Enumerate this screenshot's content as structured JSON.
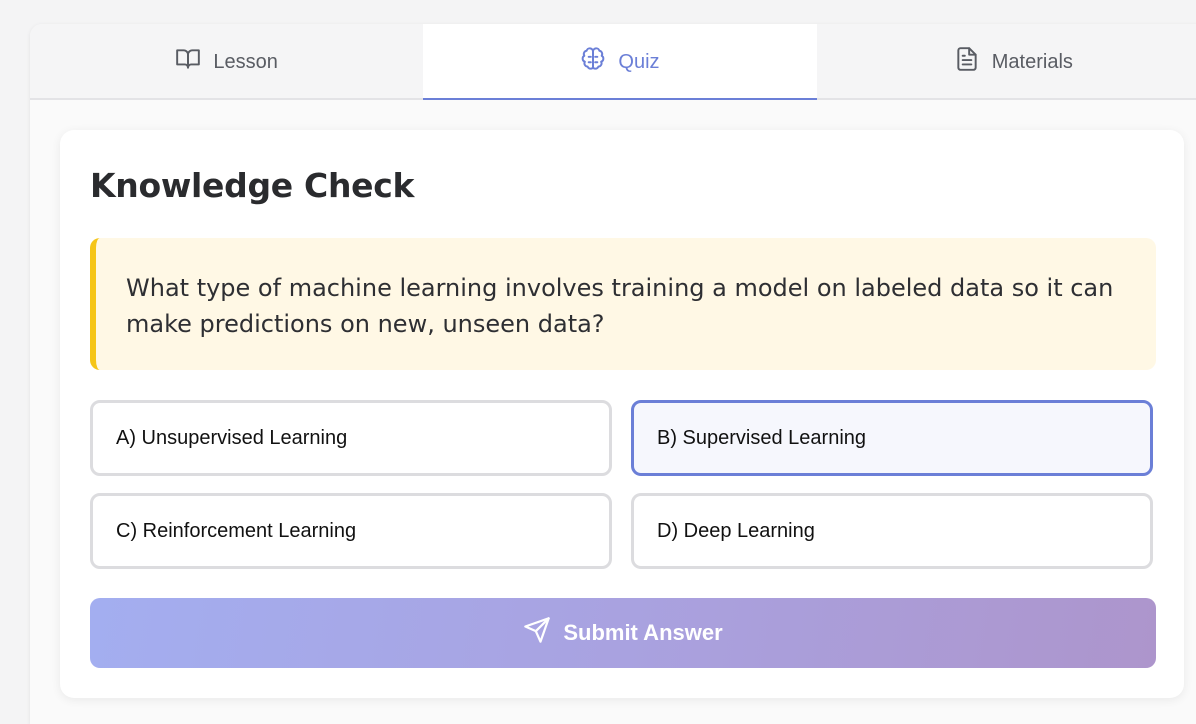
{
  "tabs": [
    {
      "label": "Lesson",
      "icon": "book-open-icon",
      "active": false
    },
    {
      "label": "Quiz",
      "icon": "brain-icon",
      "active": true
    },
    {
      "label": "Materials",
      "icon": "file-text-icon",
      "active": false
    }
  ],
  "quiz": {
    "title": "Knowledge Check",
    "question": "What type of machine learning involves training a model on labeled data so it can make predictions on new, unseen data?",
    "options": [
      {
        "label": "A) Unsupervised Learning",
        "selected": false
      },
      {
        "label": "B) Supervised Learning",
        "selected": true
      },
      {
        "label": "C) Reinforcement Learning",
        "selected": false
      },
      {
        "label": "D) Deep Learning",
        "selected": false
      }
    ],
    "submit_label": "Submit Answer",
    "submit_icon": "send-icon"
  },
  "colors": {
    "accent": "#6b7fd7",
    "question_border": "#f5c518",
    "question_bg": "#fff8e5"
  }
}
